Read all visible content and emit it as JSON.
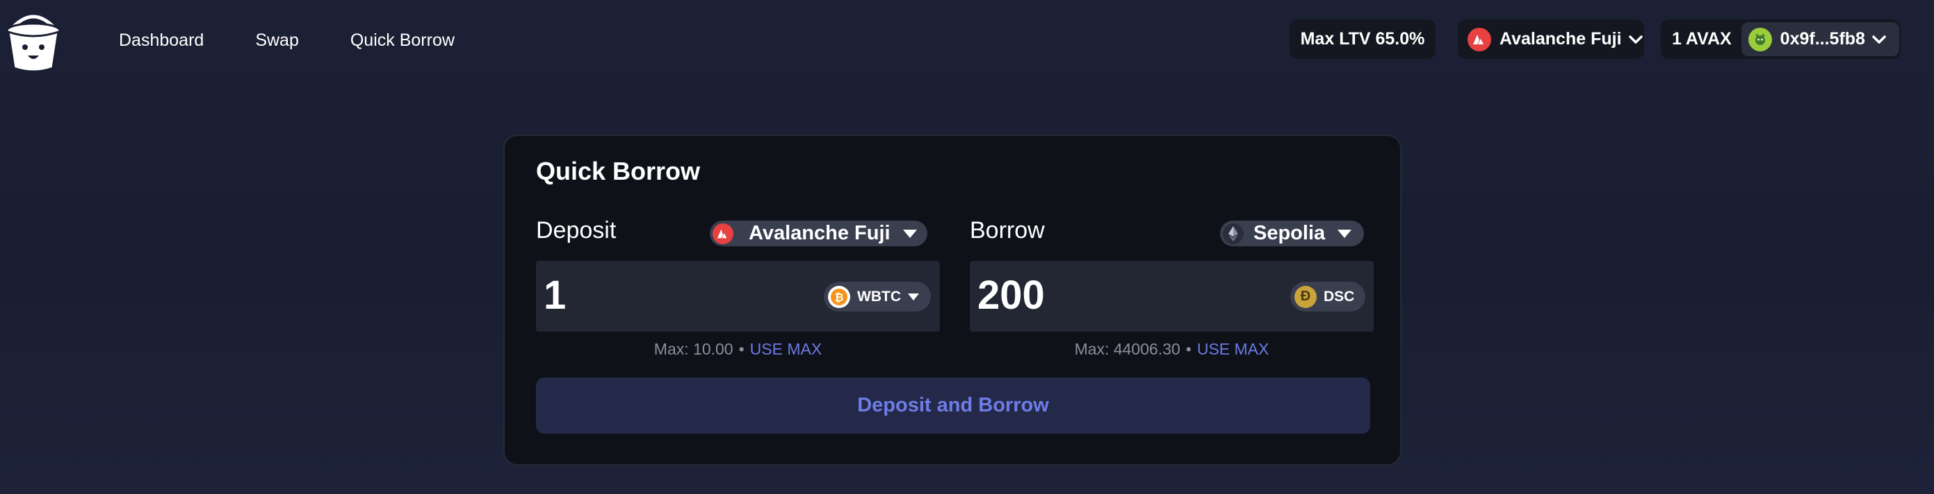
{
  "nav": {
    "items": [
      {
        "label": "Dashboard"
      },
      {
        "label": "Swap"
      },
      {
        "label": "Quick Borrow"
      }
    ]
  },
  "header": {
    "max_ltv": "Max LTV 65.0%",
    "network": "Avalanche Fuji",
    "balance": "1 AVAX",
    "address": "0x9f...5fb8"
  },
  "card": {
    "title": "Quick Borrow",
    "deposit": {
      "label": "Deposit",
      "chain": "Avalanche Fuji",
      "amount": "1",
      "token": "WBTC",
      "max": "Max: 10.00",
      "use_max": "USE MAX"
    },
    "borrow": {
      "label": "Borrow",
      "chain": "Sepolia",
      "amount": "200",
      "token": "DSC",
      "max": "Max: 44006.30",
      "use_max": "USE MAX"
    },
    "submit_label": "Deposit and Borrow"
  },
  "colors": {
    "accent": "#6e7de6",
    "avalanche": "#e84142",
    "bitcoin": "#f7931a",
    "dsc_gold": "#c9a43a"
  },
  "icons": {
    "logo": "bucket-logo-icon",
    "network": "avalanche-icon",
    "avatar": "avatar-icon",
    "deposit_token": "bitcoin-icon",
    "borrow_chain": "ethereum-icon",
    "borrow_token": "dsc-coin-icon"
  }
}
